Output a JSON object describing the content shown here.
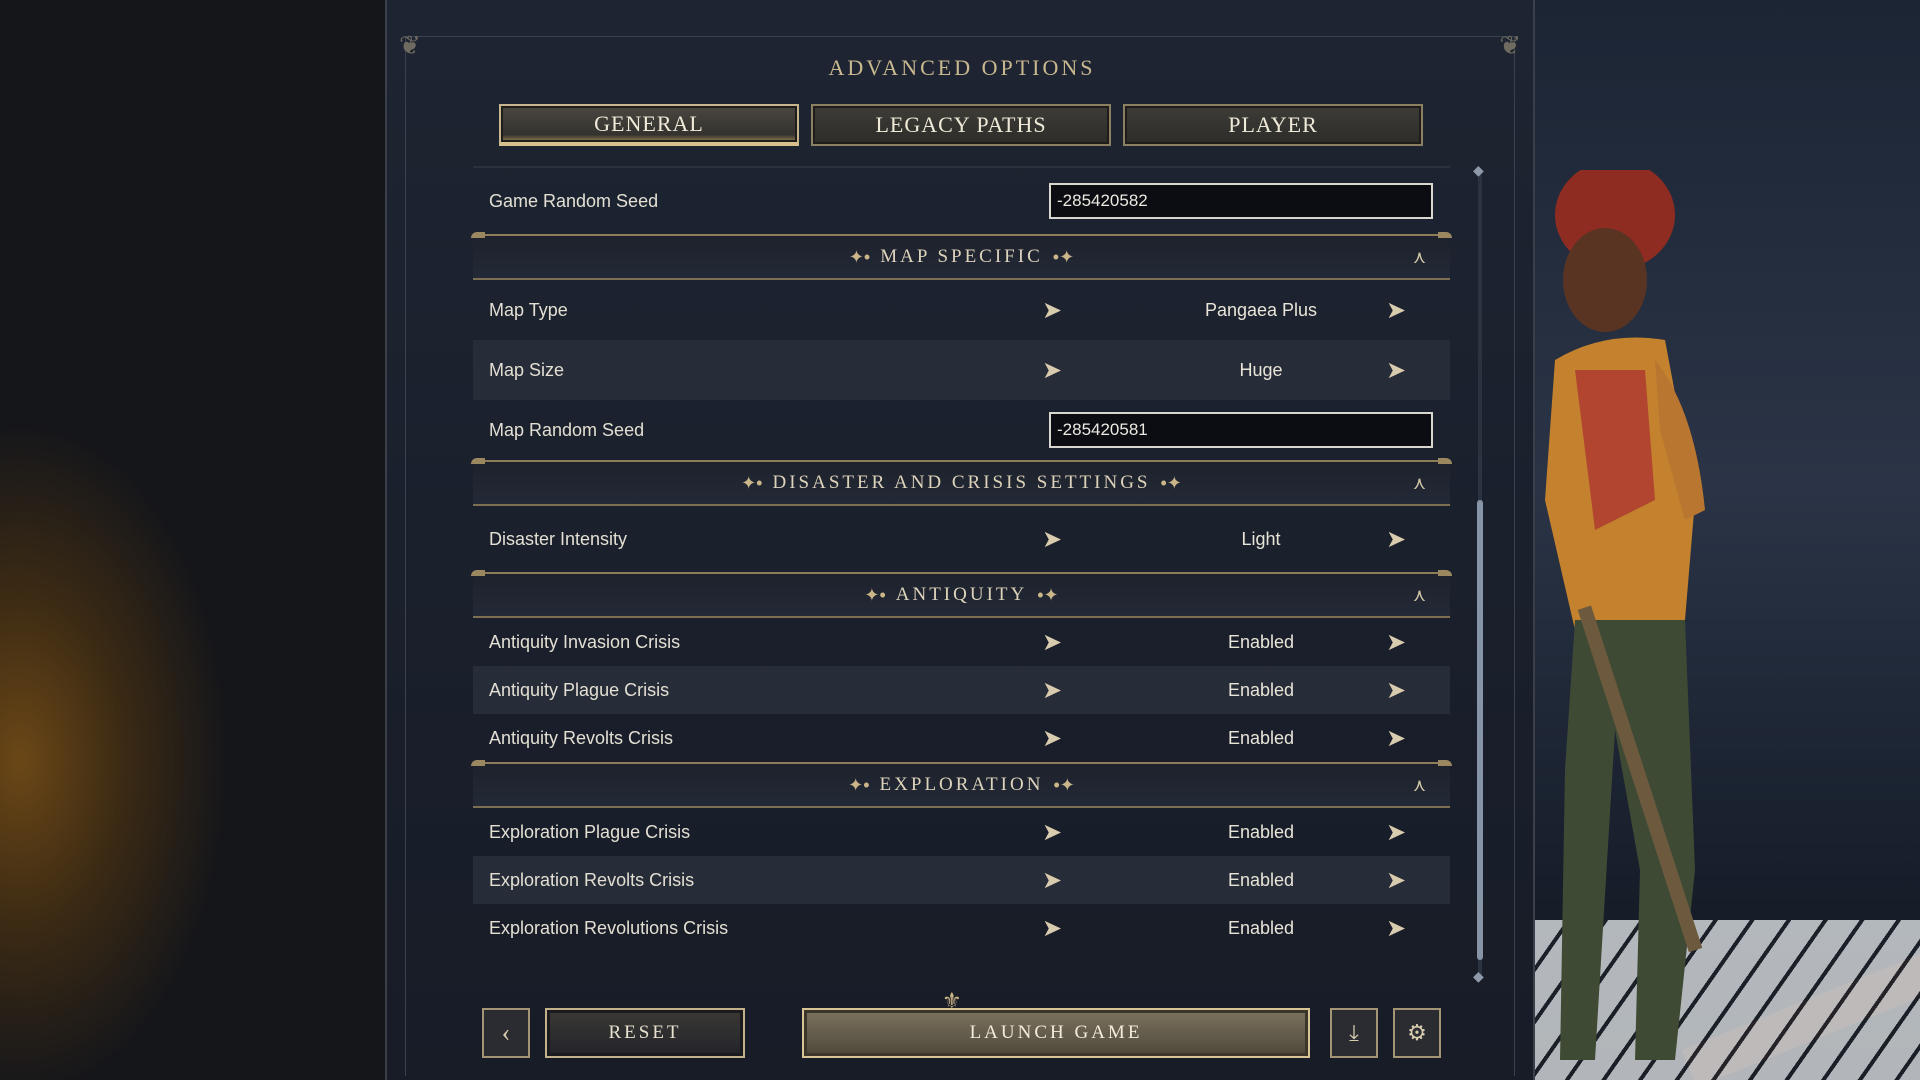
{
  "title": "ADVANCED OPTIONS",
  "tabs": [
    {
      "label": "GENERAL",
      "active": true
    },
    {
      "label": "LEGACY PATHS",
      "active": false
    },
    {
      "label": "PLAYER",
      "active": false
    }
  ],
  "general": {
    "game_random_seed_label": "Game Random Seed",
    "game_random_seed_value": "-285420582"
  },
  "map_specific": {
    "title": "MAP SPECIFIC",
    "map_type_label": "Map Type",
    "map_type_value": "Pangaea Plus",
    "map_size_label": "Map Size",
    "map_size_value": "Huge",
    "map_random_seed_label": "Map Random Seed",
    "map_random_seed_value": "-285420581"
  },
  "disaster": {
    "title": "DISASTER AND CRISIS SETTINGS",
    "intensity_label": "Disaster Intensity",
    "intensity_value": "Light"
  },
  "antiquity": {
    "title": "ANTIQUITY",
    "rows": [
      {
        "label": "Antiquity Invasion Crisis",
        "value": "Enabled"
      },
      {
        "label": "Antiquity Plague Crisis",
        "value": "Enabled"
      },
      {
        "label": "Antiquity Revolts Crisis",
        "value": "Enabled"
      }
    ]
  },
  "exploration": {
    "title": "EXPLORATION",
    "rows": [
      {
        "label": "Exploration Plague Crisis",
        "value": "Enabled"
      },
      {
        "label": "Exploration Revolts Crisis",
        "value": "Enabled"
      },
      {
        "label": "Exploration Revolutions Crisis",
        "value": "Enabled"
      }
    ]
  },
  "footer": {
    "reset_label": "RESET",
    "launch_label": "LAUNCH GAME"
  },
  "icons": {
    "back": "chevron-left-icon",
    "download": "download-icon",
    "settings": "gear-icon",
    "arrow_left": "arrow-left-icon",
    "arrow_right": "arrow-right-icon",
    "collapse": "collapse-chevron-icon"
  },
  "colors": {
    "panel_bg": "#1b212c",
    "accent_gold": "#c9b78f",
    "input_border": "#d8d6cf"
  }
}
